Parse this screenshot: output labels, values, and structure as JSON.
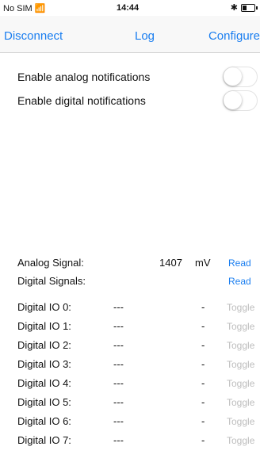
{
  "status_bar": {
    "carrier": "No SIM",
    "time": "14:44"
  },
  "nav": {
    "disconnect": "Disconnect",
    "log": "Log",
    "configure": "Configure",
    "accent": "#1a7ef0"
  },
  "settings": [
    {
      "label": "Enable analog notifications",
      "enabled": false
    },
    {
      "label": "Enable digital notifications",
      "enabled": false
    }
  ],
  "analog": {
    "label": "Analog Signal:",
    "value": "1407",
    "unit": "mV",
    "action": "Read"
  },
  "digital": {
    "label": "Digital Signals:",
    "action": "Read"
  },
  "io_rows": [
    {
      "label": "Digital IO 0:",
      "value": "---",
      "state": "-",
      "action": "Toggle"
    },
    {
      "label": "Digital IO 1:",
      "value": "---",
      "state": "-",
      "action": "Toggle"
    },
    {
      "label": "Digital IO 2:",
      "value": "---",
      "state": "-",
      "action": "Toggle"
    },
    {
      "label": "Digital IO 3:",
      "value": "---",
      "state": "-",
      "action": "Toggle"
    },
    {
      "label": "Digital IO 4:",
      "value": "---",
      "state": "-",
      "action": "Toggle"
    },
    {
      "label": "Digital IO 5:",
      "value": "---",
      "state": "-",
      "action": "Toggle"
    },
    {
      "label": "Digital IO 6:",
      "value": "---",
      "state": "-",
      "action": "Toggle"
    },
    {
      "label": "Digital IO 7:",
      "value": "---",
      "state": "-",
      "action": "Toggle"
    }
  ]
}
